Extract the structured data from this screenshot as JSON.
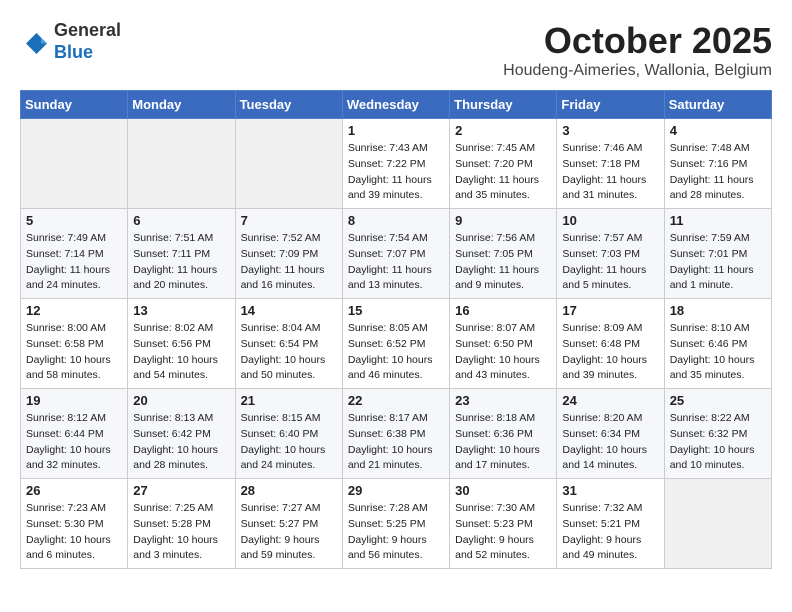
{
  "header": {
    "logo_general": "General",
    "logo_blue": "Blue",
    "month_title": "October 2025",
    "subtitle": "Houdeng-Aimeries, Wallonia, Belgium"
  },
  "weekdays": [
    "Sunday",
    "Monday",
    "Tuesday",
    "Wednesday",
    "Thursday",
    "Friday",
    "Saturday"
  ],
  "weeks": [
    [
      {
        "day": "",
        "info": ""
      },
      {
        "day": "",
        "info": ""
      },
      {
        "day": "",
        "info": ""
      },
      {
        "day": "1",
        "info": "Sunrise: 7:43 AM\nSunset: 7:22 PM\nDaylight: 11 hours\nand 39 minutes."
      },
      {
        "day": "2",
        "info": "Sunrise: 7:45 AM\nSunset: 7:20 PM\nDaylight: 11 hours\nand 35 minutes."
      },
      {
        "day": "3",
        "info": "Sunrise: 7:46 AM\nSunset: 7:18 PM\nDaylight: 11 hours\nand 31 minutes."
      },
      {
        "day": "4",
        "info": "Sunrise: 7:48 AM\nSunset: 7:16 PM\nDaylight: 11 hours\nand 28 minutes."
      }
    ],
    [
      {
        "day": "5",
        "info": "Sunrise: 7:49 AM\nSunset: 7:14 PM\nDaylight: 11 hours\nand 24 minutes."
      },
      {
        "day": "6",
        "info": "Sunrise: 7:51 AM\nSunset: 7:11 PM\nDaylight: 11 hours\nand 20 minutes."
      },
      {
        "day": "7",
        "info": "Sunrise: 7:52 AM\nSunset: 7:09 PM\nDaylight: 11 hours\nand 16 minutes."
      },
      {
        "day": "8",
        "info": "Sunrise: 7:54 AM\nSunset: 7:07 PM\nDaylight: 11 hours\nand 13 minutes."
      },
      {
        "day": "9",
        "info": "Sunrise: 7:56 AM\nSunset: 7:05 PM\nDaylight: 11 hours\nand 9 minutes."
      },
      {
        "day": "10",
        "info": "Sunrise: 7:57 AM\nSunset: 7:03 PM\nDaylight: 11 hours\nand 5 minutes."
      },
      {
        "day": "11",
        "info": "Sunrise: 7:59 AM\nSunset: 7:01 PM\nDaylight: 11 hours\nand 1 minute."
      }
    ],
    [
      {
        "day": "12",
        "info": "Sunrise: 8:00 AM\nSunset: 6:58 PM\nDaylight: 10 hours\nand 58 minutes."
      },
      {
        "day": "13",
        "info": "Sunrise: 8:02 AM\nSunset: 6:56 PM\nDaylight: 10 hours\nand 54 minutes."
      },
      {
        "day": "14",
        "info": "Sunrise: 8:04 AM\nSunset: 6:54 PM\nDaylight: 10 hours\nand 50 minutes."
      },
      {
        "day": "15",
        "info": "Sunrise: 8:05 AM\nSunset: 6:52 PM\nDaylight: 10 hours\nand 46 minutes."
      },
      {
        "day": "16",
        "info": "Sunrise: 8:07 AM\nSunset: 6:50 PM\nDaylight: 10 hours\nand 43 minutes."
      },
      {
        "day": "17",
        "info": "Sunrise: 8:09 AM\nSunset: 6:48 PM\nDaylight: 10 hours\nand 39 minutes."
      },
      {
        "day": "18",
        "info": "Sunrise: 8:10 AM\nSunset: 6:46 PM\nDaylight: 10 hours\nand 35 minutes."
      }
    ],
    [
      {
        "day": "19",
        "info": "Sunrise: 8:12 AM\nSunset: 6:44 PM\nDaylight: 10 hours\nand 32 minutes."
      },
      {
        "day": "20",
        "info": "Sunrise: 8:13 AM\nSunset: 6:42 PM\nDaylight: 10 hours\nand 28 minutes."
      },
      {
        "day": "21",
        "info": "Sunrise: 8:15 AM\nSunset: 6:40 PM\nDaylight: 10 hours\nand 24 minutes."
      },
      {
        "day": "22",
        "info": "Sunrise: 8:17 AM\nSunset: 6:38 PM\nDaylight: 10 hours\nand 21 minutes."
      },
      {
        "day": "23",
        "info": "Sunrise: 8:18 AM\nSunset: 6:36 PM\nDaylight: 10 hours\nand 17 minutes."
      },
      {
        "day": "24",
        "info": "Sunrise: 8:20 AM\nSunset: 6:34 PM\nDaylight: 10 hours\nand 14 minutes."
      },
      {
        "day": "25",
        "info": "Sunrise: 8:22 AM\nSunset: 6:32 PM\nDaylight: 10 hours\nand 10 minutes."
      }
    ],
    [
      {
        "day": "26",
        "info": "Sunrise: 7:23 AM\nSunset: 5:30 PM\nDaylight: 10 hours\nand 6 minutes."
      },
      {
        "day": "27",
        "info": "Sunrise: 7:25 AM\nSunset: 5:28 PM\nDaylight: 10 hours\nand 3 minutes."
      },
      {
        "day": "28",
        "info": "Sunrise: 7:27 AM\nSunset: 5:27 PM\nDaylight: 9 hours\nand 59 minutes."
      },
      {
        "day": "29",
        "info": "Sunrise: 7:28 AM\nSunset: 5:25 PM\nDaylight: 9 hours\nand 56 minutes."
      },
      {
        "day": "30",
        "info": "Sunrise: 7:30 AM\nSunset: 5:23 PM\nDaylight: 9 hours\nand 52 minutes."
      },
      {
        "day": "31",
        "info": "Sunrise: 7:32 AM\nSunset: 5:21 PM\nDaylight: 9 hours\nand 49 minutes."
      },
      {
        "day": "",
        "info": ""
      }
    ]
  ]
}
